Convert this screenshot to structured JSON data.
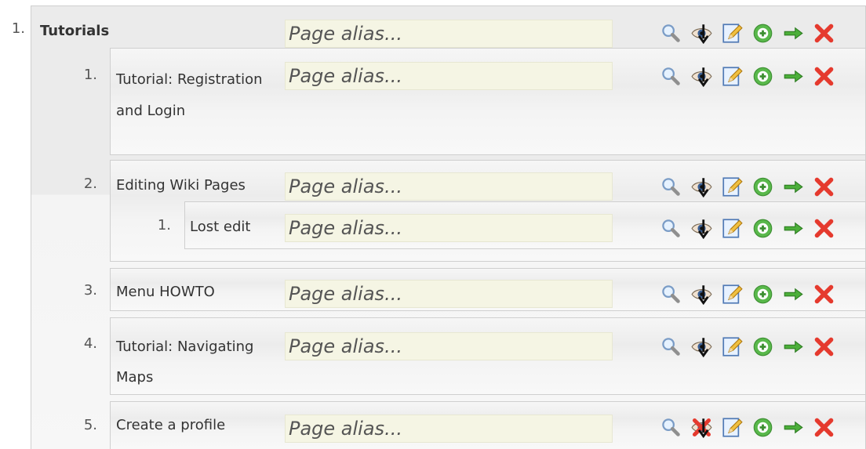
{
  "placeholder": "Page alias...",
  "items": [
    {
      "number": "1.",
      "title": "Tutorials",
      "bold": true,
      "eye": "view"
    },
    {
      "number": "1.",
      "title": "Tutorial: Registration and Login",
      "eye": "view"
    },
    {
      "number": "2.",
      "title": "Editing Wiki Pages",
      "eye": "view"
    },
    {
      "number": "1.",
      "title": "Lost edit",
      "eye": "view"
    },
    {
      "number": "3.",
      "title": "Menu HOWTO",
      "eye": "view"
    },
    {
      "number": "4.",
      "title": "Tutorial: Navigating Maps",
      "eye": "view"
    },
    {
      "number": "5.",
      "title": "Create a profile",
      "eye": "hidden"
    }
  ],
  "icons": [
    "search-icon",
    "eye-icon",
    "edit-icon",
    "add-icon",
    "arrow-right-icon",
    "delete-icon"
  ]
}
